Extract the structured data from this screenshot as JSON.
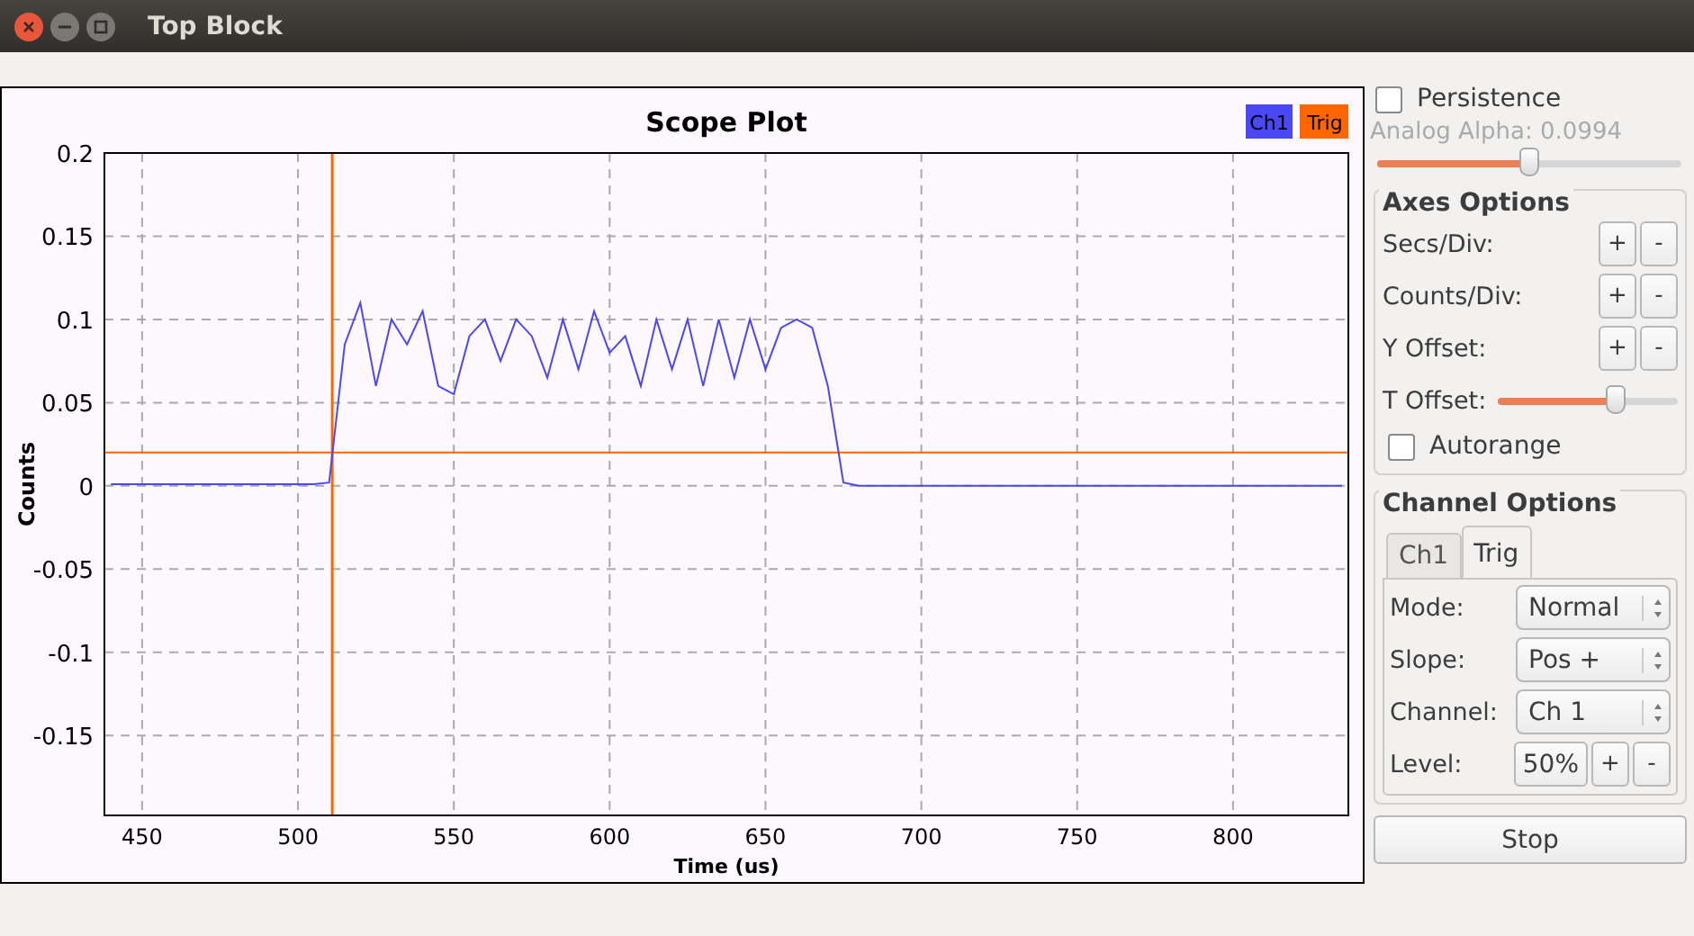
{
  "window": {
    "title": "Top Block"
  },
  "plot": {
    "trigger": {
      "label": "Trig",
      "color": "#ff6600"
    },
    "chart_data": {
      "type": "line",
      "title": "Scope Plot",
      "xlabel": "Time (us)",
      "ylabel": "Counts",
      "xlim": [
        437.9,
        837
      ],
      "ylim": [
        -0.198,
        0.2
      ],
      "xticks": [
        450,
        500,
        550,
        600,
        650,
        700,
        750,
        800
      ],
      "yticks": [
        -0.15,
        -0.1,
        -0.05,
        0,
        0.05,
        0.1,
        0.15,
        0.2
      ],
      "x": [
        440,
        445,
        450,
        455,
        460,
        465,
        470,
        475,
        480,
        485,
        490,
        495,
        500,
        505,
        510,
        515,
        520,
        525,
        530,
        535,
        540,
        545,
        550,
        555,
        560,
        565,
        570,
        575,
        580,
        585,
        590,
        595,
        600,
        605,
        610,
        615,
        620,
        625,
        630,
        635,
        640,
        645,
        650,
        655,
        660,
        665,
        670,
        675,
        680,
        685,
        690,
        695,
        700,
        705,
        710,
        715,
        720,
        725,
        730,
        735,
        740,
        745,
        750,
        755,
        760,
        765,
        770,
        775,
        780,
        785,
        790,
        795,
        800,
        805,
        810,
        815,
        820,
        825,
        830,
        835
      ],
      "series": [
        {
          "name": "Ch1",
          "color": "#4a47f5",
          "values": [
            0.001,
            0.001,
            0.001,
            0.001,
            0.001,
            0.001,
            0.001,
            0.001,
            0.001,
            0.001,
            0.001,
            0.001,
            0.001,
            0.001,
            0.002,
            0.085,
            0.11,
            0.06,
            0.1,
            0.085,
            0.105,
            0.06,
            0.055,
            0.09,
            0.1,
            0.075,
            0.1,
            0.09,
            0.065,
            0.1,
            0.07,
            0.105,
            0.08,
            0.09,
            0.06,
            0.1,
            0.07,
            0.1,
            0.06,
            0.1,
            0.065,
            0.1,
            0.07,
            0.095,
            0.1,
            0.095,
            0.06,
            0.002,
            0,
            0,
            0,
            0,
            0,
            0,
            0,
            0,
            0,
            0,
            0,
            0,
            0,
            0,
            0,
            0,
            0,
            0,
            0,
            0,
            0,
            0,
            0,
            0,
            0,
            0,
            0,
            0,
            0,
            0,
            0,
            0
          ]
        }
      ],
      "grid": true,
      "ref_lines": [
        {
          "axis": "x",
          "value": 511
        },
        {
          "axis": "y",
          "value": 0.02
        }
      ]
    }
  },
  "persistence": {
    "label": "Persistence",
    "checked": false
  },
  "analog_alpha": {
    "label": "Analog Alpha: 0.0994",
    "disabled": true,
    "level": 0.5
  },
  "axes_options": {
    "title": "Axes Options",
    "rows": [
      {
        "kind": "stepper",
        "label": "Secs/Div:",
        "plus": "+",
        "minus": "-"
      },
      {
        "kind": "stepper",
        "label": "Counts/Div:",
        "plus": "+",
        "minus": "-"
      },
      {
        "kind": "stepper",
        "label": "Y Offset:",
        "plus": "+",
        "minus": "-"
      },
      {
        "kind": "slider",
        "label": "T Offset:",
        "level": 0.66
      }
    ],
    "autorange": {
      "label": "Autorange",
      "checked": false
    }
  },
  "channel_options": {
    "title": "Channel Options",
    "tabs": [
      {
        "label": "Ch1",
        "selected": false
      },
      {
        "label": "Trig",
        "selected": true
      }
    ],
    "rows": [
      {
        "kind": "combo",
        "label": "Mode:",
        "value": "Normal"
      },
      {
        "kind": "combo",
        "label": "Slope:",
        "value": "Pos +"
      },
      {
        "kind": "combo",
        "label": "Channel:",
        "value": "Ch 1"
      },
      {
        "kind": "stepper",
        "label": "Level:",
        "value": "50%",
        "plus": "+",
        "minus": "-"
      }
    ]
  },
  "stop_button": "Stop"
}
